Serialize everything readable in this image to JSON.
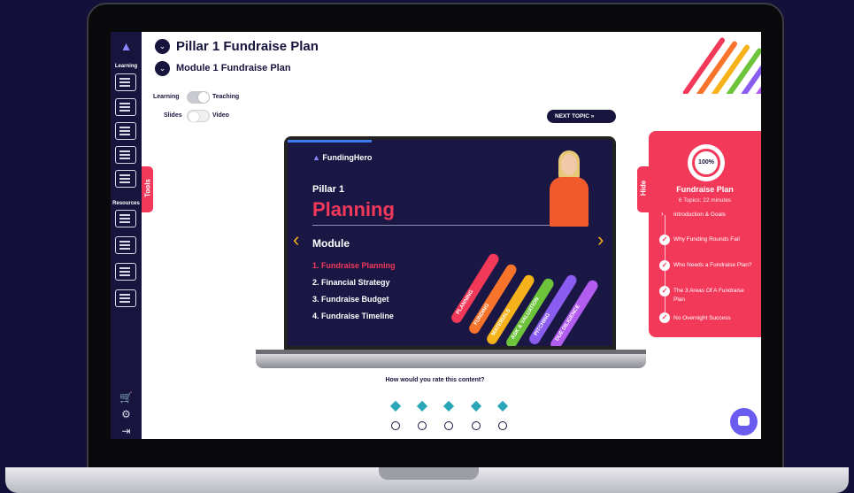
{
  "header": {
    "title": "Pillar 1 Fundraise Plan",
    "module_title": "Module 1 Fundraise Plan"
  },
  "sidebar": {
    "learning_label": "Learning",
    "resources_label": "Resources",
    "tools_tab": "Tools"
  },
  "toggles": {
    "mode_left": "Learning",
    "mode_right": "Teaching",
    "format_left": "Slides",
    "format_right": "Video"
  },
  "next_topic_label": "NEXT TOPIC",
  "slide": {
    "logo": "FundingHero",
    "pillar_small": "Pillar 1",
    "pillar_big": "Planning",
    "module_heading": "Module",
    "modules": [
      "1. Fundraise Planning",
      "2. Financial Strategy",
      "3. Fundraise Budget",
      "4. Fundraise Timeline"
    ],
    "stripes": [
      {
        "label": "PLANNING",
        "color": "#f2395a"
      },
      {
        "label": "FUNDING",
        "color": "#f7742a"
      },
      {
        "label": "MATERIALS",
        "color": "#f6b21a"
      },
      {
        "label": "ASK & VALUATION",
        "color": "#6dc43a"
      },
      {
        "label": "PITCHING",
        "color": "#8a5cf0"
      },
      {
        "label": "DUE DILIGENCE",
        "color": "#b25cf0"
      }
    ]
  },
  "panel": {
    "hide_tab": "Hide",
    "progress": "100%",
    "title": "Fundraise Plan",
    "subtitle": "6 Topics: 22 minutes",
    "items": [
      "Introduction & Goals",
      "Why Funding Rounds Fail",
      "Who Needs a Fundraise Plan?",
      "The 3 Areas Of A Fundraise Plan",
      "No Overnight Success"
    ]
  },
  "rating": {
    "question": "How would you rate this content?"
  },
  "colors": {
    "brand_navy": "#17143d",
    "accent_pink": "#f2395a",
    "chat": "#6b5cf0"
  }
}
